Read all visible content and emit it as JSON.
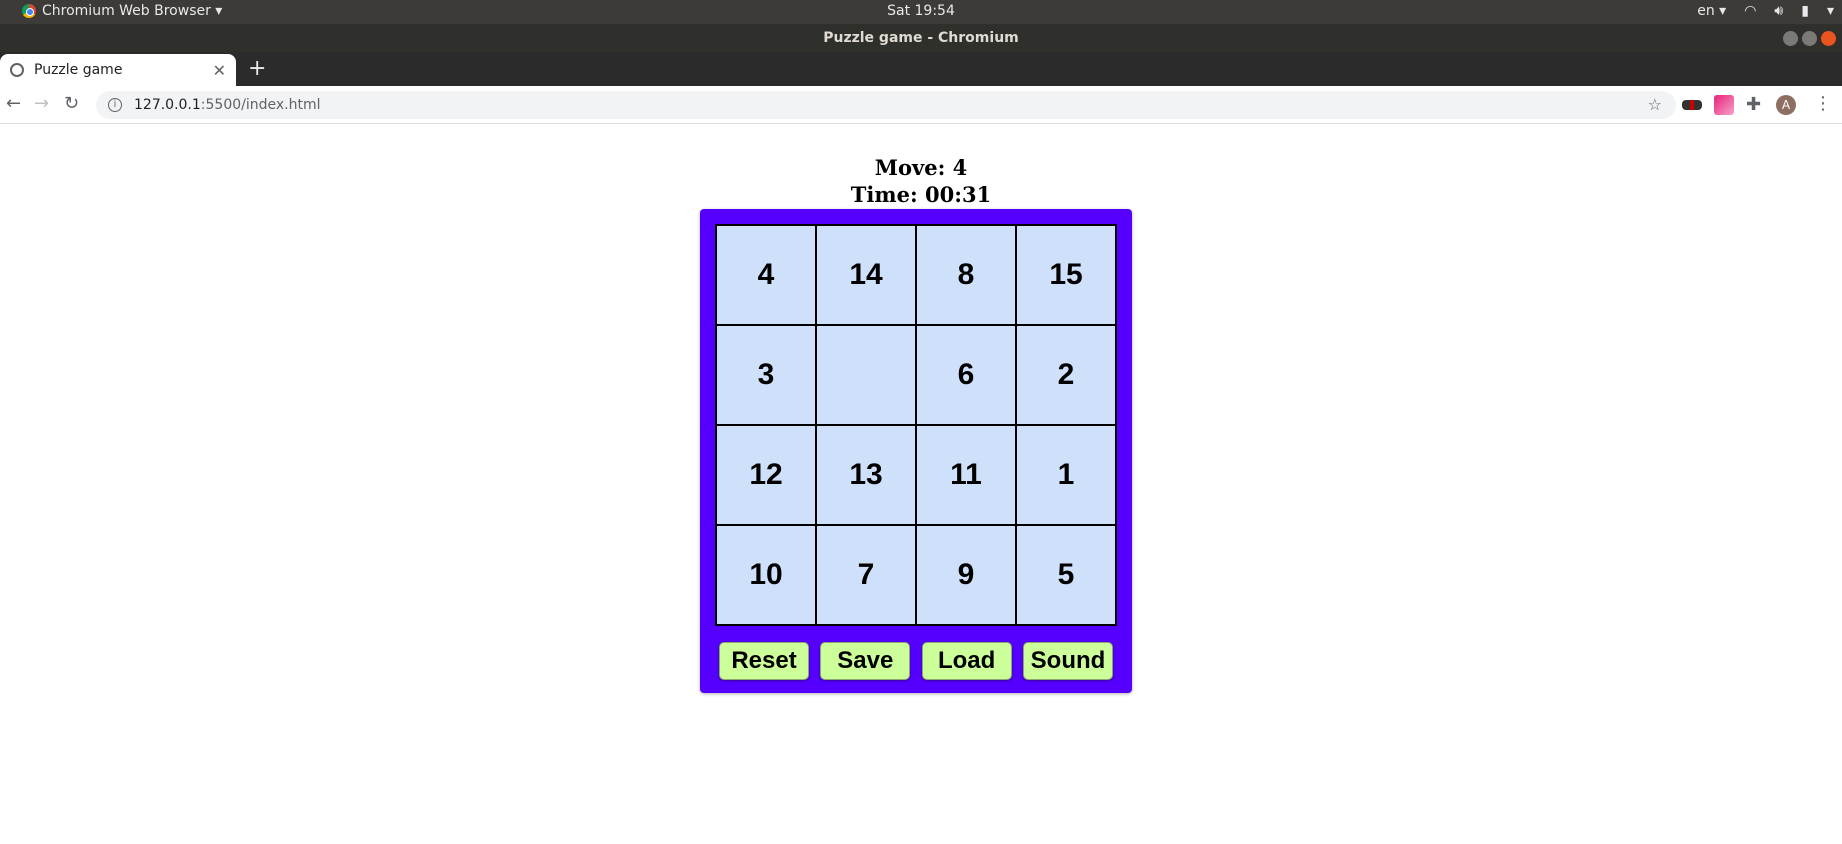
{
  "os_bar": {
    "app_name": "Chromium Web Browser ▾",
    "clock": "Sat 19:54",
    "language": "en ▾"
  },
  "window": {
    "title": "Puzzle game - Chromium"
  },
  "browser": {
    "tab_title": "Puzzle game",
    "url_host": "127.0.0.1",
    "url_path": ":5500/index.html",
    "avatar_letter": "A"
  },
  "game": {
    "move_label": "Move: 4",
    "time_label": "Time: 00:31",
    "tiles": [
      "4",
      "14",
      "8",
      "15",
      "3",
      "",
      "6",
      "2",
      "12",
      "13",
      "11",
      "1",
      "10",
      "7",
      "9",
      "5"
    ],
    "buttons": {
      "reset": "Reset",
      "save": "Save",
      "load": "Load",
      "sound": "Sound"
    },
    "colors": {
      "frame": "#5500ff",
      "tile": "#cfe1fa",
      "button": "#ccff99"
    }
  }
}
